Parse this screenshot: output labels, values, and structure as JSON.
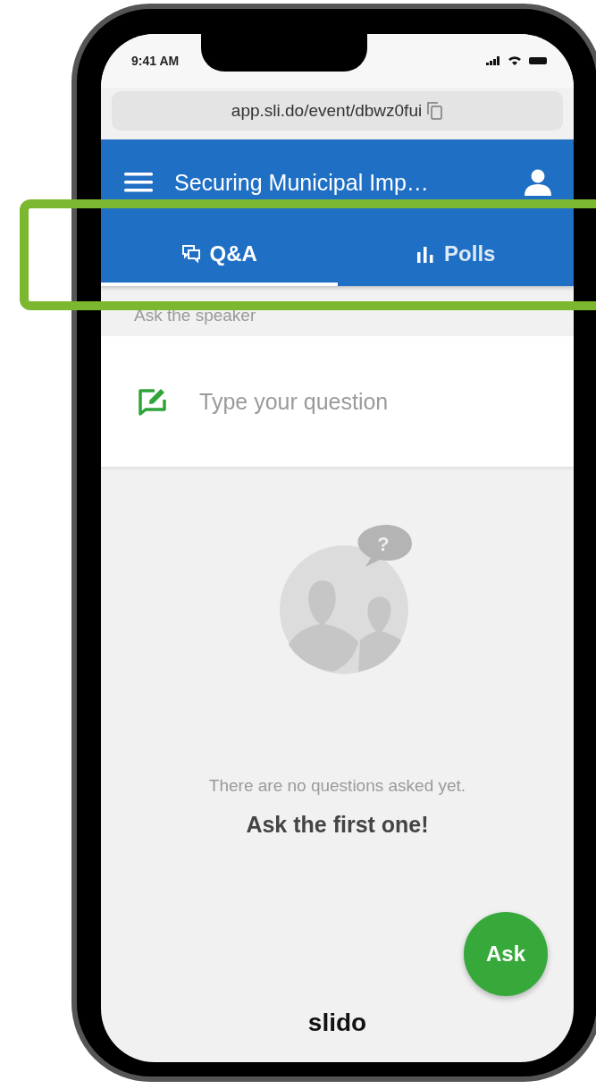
{
  "status_bar": {
    "time": "9:41 AM"
  },
  "address_bar": {
    "url": "app.sli.do/event/dbwz0fui"
  },
  "header": {
    "title": "Securing Municipal Imp…"
  },
  "tabs": [
    {
      "label": "Q&A",
      "kind": "chat",
      "selected": true
    },
    {
      "label": "Polls",
      "kind": "bars",
      "selected": false
    }
  ],
  "section_label": "Ask the speaker",
  "question_field": {
    "placeholder": "Type your question"
  },
  "empty_state": {
    "bubble_mark": "?",
    "message": "There are no questions asked yet.",
    "prompt": "Ask the first one!"
  },
  "ask_button": "Ask",
  "logo": "slido"
}
